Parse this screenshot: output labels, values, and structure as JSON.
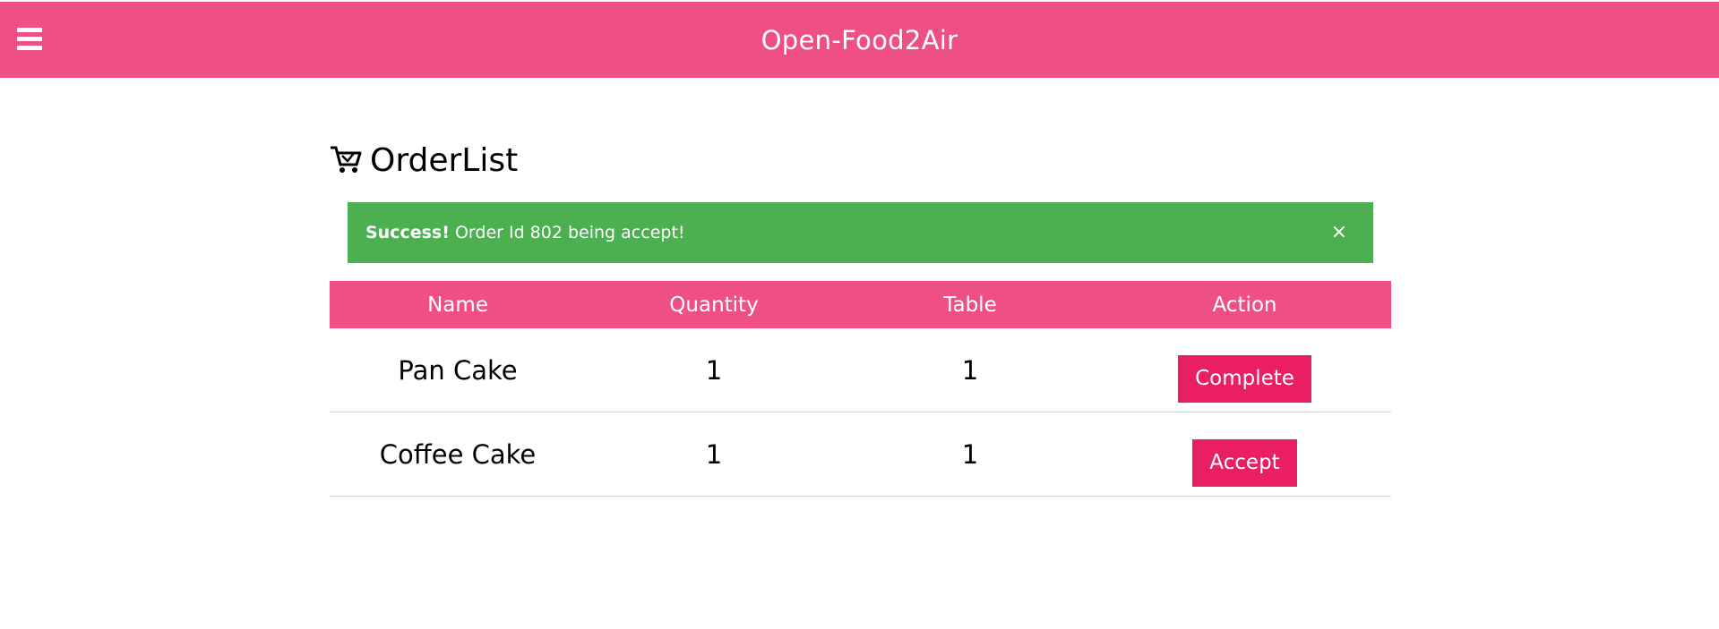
{
  "header": {
    "title": "Open-Food2Air",
    "menu_icon": "hamburger-menu-icon",
    "background": "#ef5083"
  },
  "page": {
    "title": "OrderList",
    "title_icon": "shopping-cart-icon"
  },
  "alert": {
    "strong": "Success!",
    "message": " Order Id 802 being accept!",
    "close": "×",
    "color": "#4caf50"
  },
  "table": {
    "columns": [
      "Name",
      "Quantity",
      "Table",
      "Action"
    ],
    "rows": [
      {
        "name": "Pan Cake",
        "quantity": "1",
        "table": "1",
        "action": "Complete"
      },
      {
        "name": "Coffee Cake",
        "quantity": "1",
        "table": "1",
        "action": "Accept"
      }
    ]
  },
  "colors": {
    "button": "#e91e63",
    "header_row": "#ef5083"
  }
}
